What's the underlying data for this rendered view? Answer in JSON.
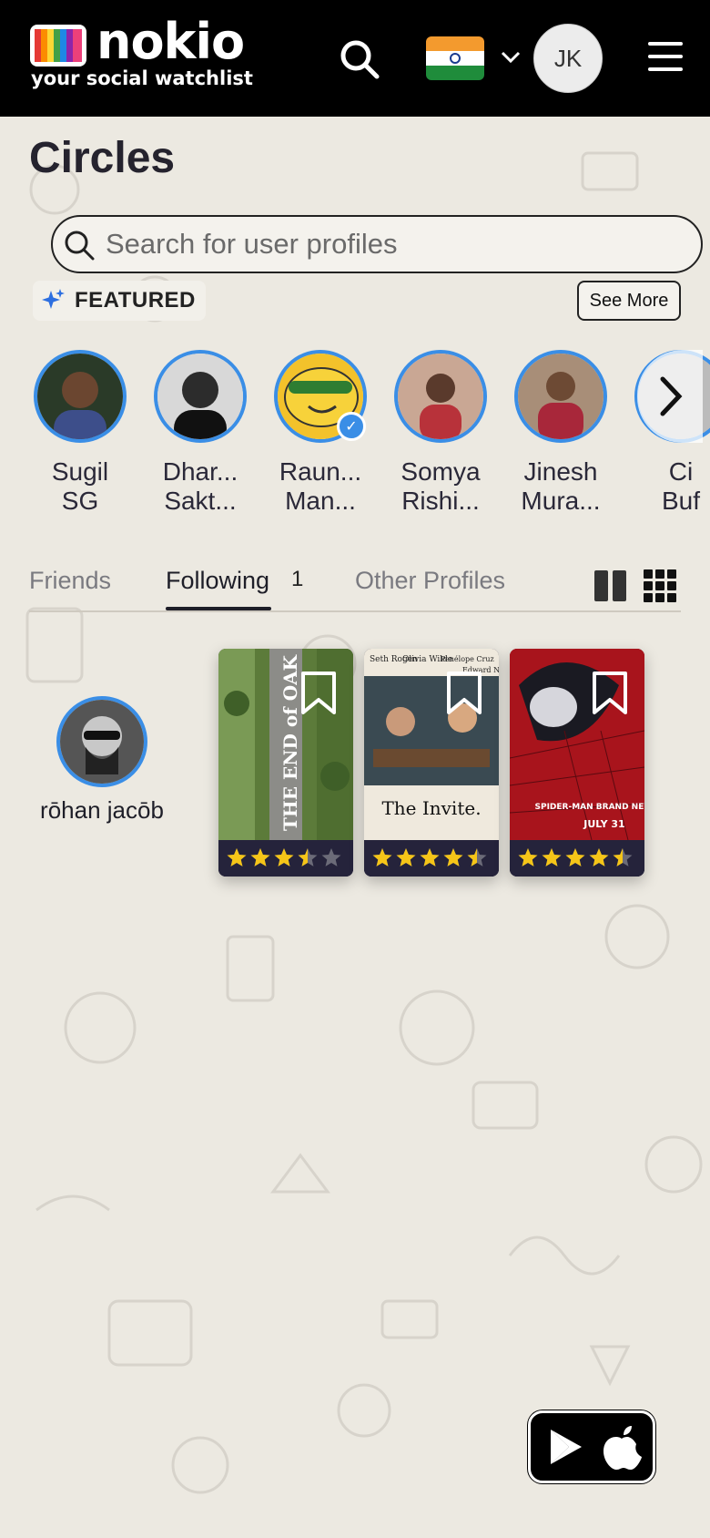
{
  "header": {
    "logo_name": "nokio",
    "logo_tagline": "your social watchlist",
    "avatar_initials": "JK"
  },
  "page": {
    "title": "Circles"
  },
  "search": {
    "placeholder": "Search for user profiles"
  },
  "featured": {
    "label": "FEATURED",
    "see_more_label": "See More",
    "profiles": [
      {
        "name": "Sugil\nSG",
        "verified": false
      },
      {
        "name": "Dhar...\nSakt...",
        "verified": false
      },
      {
        "name": "Raun...\nMan...",
        "verified": true
      },
      {
        "name": "Somya\nRishi...",
        "verified": false
      },
      {
        "name": "Jinesh\nMura...",
        "verified": false
      },
      {
        "name": "Ci\nBuf",
        "verified": false
      }
    ]
  },
  "tabs": {
    "items": [
      {
        "label": "Friends"
      },
      {
        "label": "Following",
        "count": "1"
      },
      {
        "label": "Other Profiles"
      }
    ],
    "active": "Following"
  },
  "following": [
    {
      "user_name": "rōhan jacōb",
      "watchlist": [
        {
          "title": "THE END of OAK STREET",
          "rating": 3.5,
          "max": 5
        },
        {
          "title": "The Invite.",
          "rating": 4.5,
          "max": 5,
          "credits": [
            "Seth Rogen",
            "Olivia Wilde",
            "Penélope Cruz",
            "Edward Norton"
          ]
        },
        {
          "title": "SPIDER-MAN BRAND NEW DAY",
          "rating": 4.5,
          "max": 5,
          "date": "JULY 31"
        }
      ]
    }
  ],
  "colors": {
    "header_bg": "#000000",
    "page_bg": "#ece9e1",
    "accent_blue": "#3a8ee6",
    "star": "#f5c518"
  },
  "app_badge": {
    "icons": [
      "google-play-icon",
      "apple-icon"
    ]
  }
}
